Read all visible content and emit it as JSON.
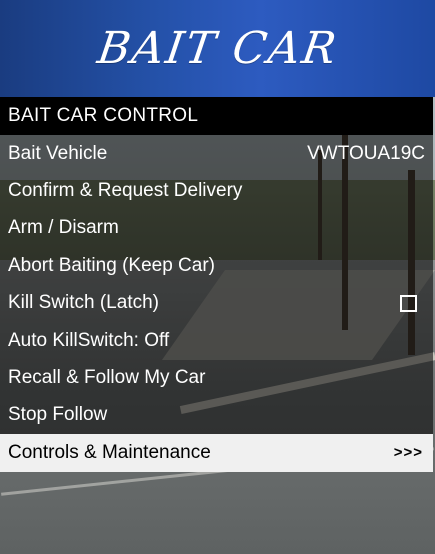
{
  "banner": {
    "title": "BAIT CAR"
  },
  "menu": {
    "header": "BAIT CAR CONTROL",
    "items": [
      {
        "label": "Bait Vehicle",
        "value": "VWTOUA19C"
      },
      {
        "label": "Confirm & Request Delivery"
      },
      {
        "label": "Arm / Disarm"
      },
      {
        "label": "Abort Baiting (Keep Car)"
      },
      {
        "label": "Kill Switch (Latch)",
        "checkbox": false
      },
      {
        "label": "Auto KillSwitch: Off"
      },
      {
        "label": "Recall & Follow My Car"
      },
      {
        "label": "Stop Follow"
      },
      {
        "label": "Controls & Maintenance",
        "submenu_indicator": ">>>",
        "selected": true
      }
    ]
  },
  "colors": {
    "banner_blue": "#2451a8",
    "menu_header_bg": "#000000",
    "item_bg": "rgba(0,0,0,0.55)",
    "selected_bg": "#f0f0f0"
  }
}
